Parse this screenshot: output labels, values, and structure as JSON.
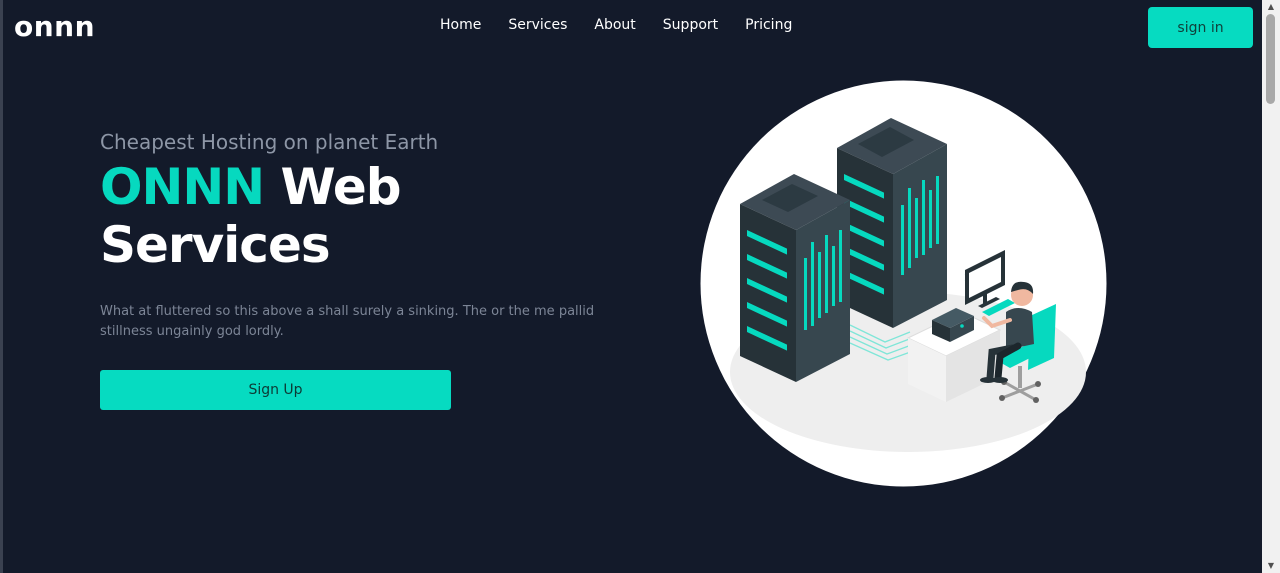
{
  "brand": {
    "logo": "onnn"
  },
  "nav": {
    "items": [
      {
        "label": "Home"
      },
      {
        "label": "Services"
      },
      {
        "label": "About"
      },
      {
        "label": "Support"
      },
      {
        "label": "Pricing"
      }
    ],
    "signin_label": "sign in"
  },
  "hero": {
    "tagline": "Cheapest Hosting on planet Earth",
    "title_accent": "ONNN",
    "title_rest": "Web Services",
    "description": "What at fluttered so this above a shall surely a sinking. The or the me pallid stillness ungainly god lordly.",
    "cta_label": "Sign Up",
    "illustration": "server-room-person-at-computer"
  },
  "colors": {
    "background": "#131a2a",
    "accent": "#06dbc1",
    "text": "#ffffff",
    "muted": "#8d96a6"
  }
}
